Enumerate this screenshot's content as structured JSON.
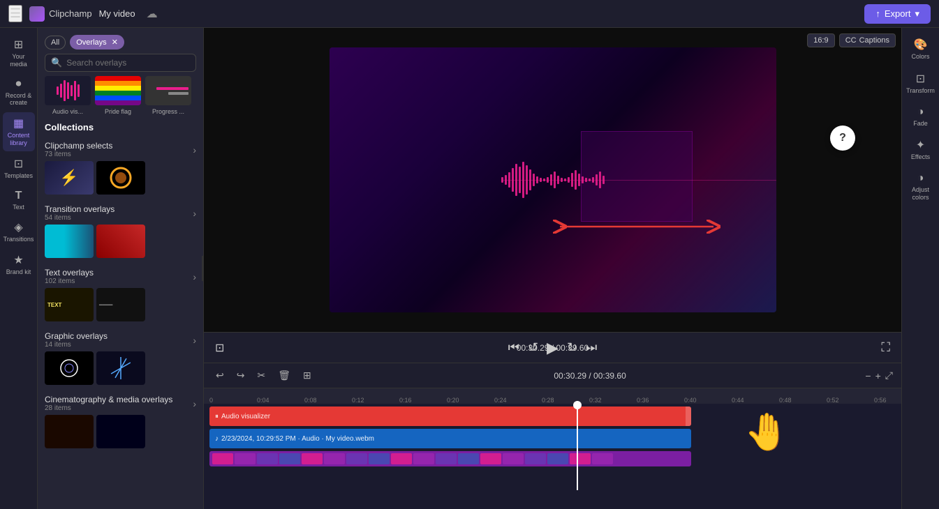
{
  "topbar": {
    "app_name": "Clipchamp",
    "video_title": "My video",
    "export_label": "Export",
    "hamburger_icon": "☰",
    "cloud_icon": "☁"
  },
  "left_sidebar": {
    "items": [
      {
        "id": "your-media",
        "icon": "⊞",
        "label": "Your media"
      },
      {
        "id": "record-create",
        "icon": "⏺",
        "label": "Record & create"
      },
      {
        "id": "content-library",
        "icon": "▦",
        "label": "Content library"
      },
      {
        "id": "templates",
        "icon": "⊡",
        "label": "Templates"
      },
      {
        "id": "text",
        "icon": "T",
        "label": "Text"
      },
      {
        "id": "transitions",
        "icon": "◈",
        "label": "Transitions"
      },
      {
        "id": "brand-kit",
        "icon": "★",
        "label": "Brand kit"
      }
    ]
  },
  "overlays_panel": {
    "title": "Overlays",
    "filters": [
      {
        "id": "all",
        "label": "All",
        "active": false
      },
      {
        "id": "overlays",
        "label": "Overlays",
        "active": true
      }
    ],
    "search_placeholder": "Search overlays",
    "featured": [
      {
        "id": "audio-vis",
        "label": "Audio vis..."
      },
      {
        "id": "pride-flag",
        "label": "Pride flag"
      },
      {
        "id": "progress",
        "label": "Progress ..."
      }
    ],
    "collections_title": "Collections",
    "collections": [
      {
        "id": "clipchamp-selects",
        "name": "Clipchamp selects",
        "count": "73 items"
      },
      {
        "id": "transition-overlays",
        "name": "Transition overlays",
        "count": "54 items"
      },
      {
        "id": "text-overlays",
        "name": "Text overlays",
        "count": "102 items"
      },
      {
        "id": "graphic-overlays",
        "name": "Graphic overlays",
        "count": "14 items"
      },
      {
        "id": "cinema-media",
        "name": "Cinematography & media overlays",
        "count": "28 items"
      }
    ]
  },
  "video_controls": {
    "aspect_ratio": "16:9",
    "captions_label": "Captions",
    "time_current": "00:30.29",
    "time_total": "00:39.60",
    "time_separator": "/"
  },
  "right_sidebar": {
    "items": [
      {
        "id": "colors",
        "icon": "🎨",
        "label": "Colors"
      },
      {
        "id": "transform",
        "icon": "⊡",
        "label": "Transform"
      },
      {
        "id": "fade",
        "icon": "◑",
        "label": "Fade"
      },
      {
        "id": "effects",
        "icon": "✦",
        "label": "Effects"
      },
      {
        "id": "adjust-colors",
        "icon": "◑",
        "label": "Adjust colors"
      }
    ]
  },
  "timeline": {
    "toolbar": {
      "undo_icon": "↩",
      "redo_icon": "↪",
      "cut_icon": "✂",
      "delete_icon": "🗑",
      "media_icon": "⊞",
      "zoom_out_icon": "−",
      "zoom_in_icon": "+"
    },
    "time_display": "00:30.29 / 00:39.60",
    "ruler_marks": [
      "0",
      "0:04",
      "0:08",
      "0:12",
      "0:16",
      "0:20",
      "0:24",
      "0:28",
      "0:32",
      "0:36",
      "0:40",
      "0:44",
      "0:48",
      "0:52",
      "0:56"
    ],
    "tracks": [
      {
        "id": "audio-visualizer",
        "label": "Audio visualizer",
        "type": "overlay",
        "color": "#e53935",
        "icon": "⏸"
      },
      {
        "id": "audio-file",
        "label": "2/23/2024, 10:29:52 PM · Audio · My video.webm",
        "type": "audio",
        "color": "#1565c0",
        "icon": "♪"
      },
      {
        "id": "color-track",
        "label": "",
        "type": "color",
        "color": "#7b1fa2"
      }
    ]
  }
}
